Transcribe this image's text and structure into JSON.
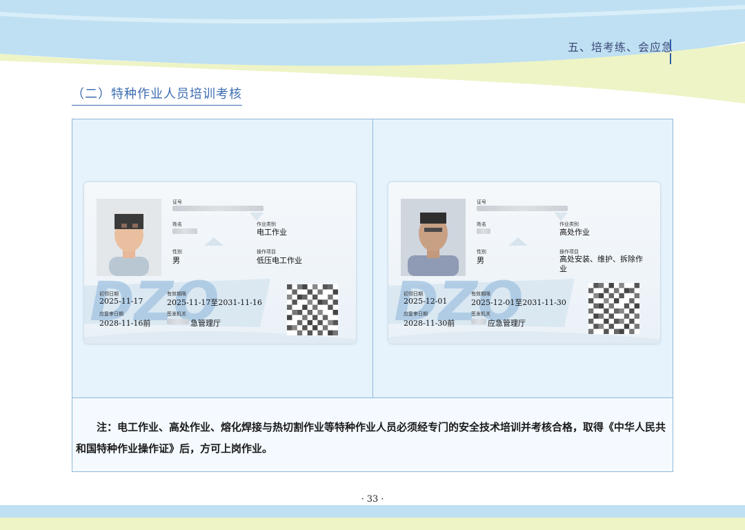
{
  "header": {
    "chapter_title": "五、培考练、会应急"
  },
  "section": {
    "title": "（二）特种作业人员培训考核"
  },
  "cards": [
    {
      "label_cert_no": "证号",
      "label_name": "姓名",
      "label_gender": "性别",
      "gender": "男",
      "label_category": "作业类别",
      "category": "电工作业",
      "label_item": "操作项目",
      "item": "低压电工作业",
      "label_first_issue": "初领日期",
      "first_issue": "2025-11-17",
      "label_valid": "有效期限",
      "valid": "2025-11-17至2031-11-16",
      "label_review": "应复审日期",
      "review": "2028-11-16前",
      "label_authority": "签发机关",
      "authority": "急管理厅"
    },
    {
      "label_cert_no": "证号",
      "label_name": "姓名",
      "label_gender": "性别",
      "gender": "男",
      "label_category": "作业类别",
      "category": "高处作业",
      "label_item": "操作项目",
      "item": "高处安装、维护、拆除作业",
      "label_first_issue": "初领日期",
      "first_issue": "2025-12-01",
      "label_valid": "有效期限",
      "valid": "2025-12-01至2031-11-30",
      "label_review": "应复审日期",
      "review": "2028-11-30前",
      "label_authority": "签发机关",
      "authority": "应急管理厅"
    }
  ],
  "note": "注：电工作业、高处作业、熔化焊接与热切割作业等特种作业人员必须经专门的安全技术培训并考核合格，取得《中华人民共和国特种作业操作证》后，方可上岗作业。",
  "footer": {
    "page_number": "· 33 ·"
  },
  "colors": {
    "accent_blue": "#3c6db1",
    "frame_border": "#8fb6d8",
    "panel_bg": "#e6f3fc",
    "wave_blue": "#bfe0f2",
    "wave_green": "#eef4c6"
  }
}
